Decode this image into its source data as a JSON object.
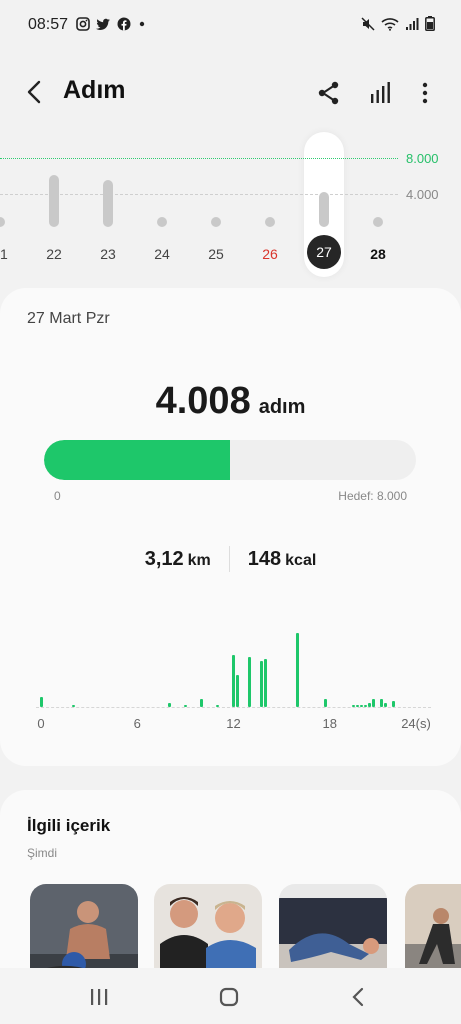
{
  "status": {
    "time": "08:57",
    "left_icons": [
      "instagram-icon",
      "twitter-icon",
      "facebook-icon",
      "dot-icon"
    ],
    "right_icons": [
      "mute-icon",
      "wifi-icon",
      "signal-icon",
      "battery-icon"
    ]
  },
  "header": {
    "title": "Adım",
    "actions": [
      "share-icon",
      "bar-chart-icon",
      "more-vertical-icon"
    ]
  },
  "week": {
    "goal_label": "8.000",
    "mid_label": "4.000",
    "days": [
      {
        "label": "21",
        "steps": 600,
        "style": "normal"
      },
      {
        "label": "22",
        "steps": 6000,
        "style": "normal"
      },
      {
        "label": "23",
        "steps": 5400,
        "style": "normal"
      },
      {
        "label": "24",
        "steps": 0,
        "style": "normal"
      },
      {
        "label": "25",
        "steps": 0,
        "style": "normal"
      },
      {
        "label": "26",
        "steps": 600,
        "style": "red"
      },
      {
        "label": "27",
        "steps": 4008,
        "style": "selected"
      },
      {
        "label": "28",
        "steps": 600,
        "style": "bold"
      }
    ]
  },
  "summary": {
    "date": "27 Mart Pzr",
    "steps": "4.008",
    "unit": "adım",
    "progress_fraction": 0.501,
    "progress_min": "0",
    "progress_goal": "Hedef: 8.000",
    "distance_value": "3,12",
    "distance_unit": "km",
    "calories_value": "148",
    "calories_unit": "kcal"
  },
  "chart_data": {
    "type": "bar",
    "x": [
      0,
      1,
      2,
      3,
      4,
      5,
      6,
      7,
      8,
      9,
      10,
      11,
      12,
      13,
      14,
      15,
      16,
      17,
      18,
      19,
      20,
      21,
      22,
      23,
      0.25,
      0.5,
      0.75,
      1.25,
      1.5,
      1.75,
      2.25,
      2.5,
      2.75,
      3.25,
      3.5,
      3.75,
      4.25,
      4.5,
      4.75,
      5.25,
      5.5,
      5.75,
      6.25,
      6.5,
      6.75,
      7.25,
      7.5,
      7.75,
      8.25,
      8.5,
      8.75,
      9.25,
      9.5,
      9.75,
      10.25,
      10.5,
      10.75,
      11.25,
      11.5,
      11.75,
      12.25,
      12.5,
      12.75,
      13.25,
      13.5,
      13.75,
      14.25,
      14.5,
      14.75,
      15.25,
      15.5,
      15.75,
      16.25,
      16.5,
      16.75,
      17.25,
      17.5,
      17.75,
      18.25,
      18.5,
      18.75,
      19.25,
      19.5,
      19.75,
      20.25,
      20.5,
      20.75,
      21.25,
      21.5,
      21.75,
      22.25,
      22.5,
      22.75,
      23.25,
      23.5,
      23.75
    ],
    "values": [
      10,
      0,
      2,
      0,
      0,
      0,
      0,
      0,
      4,
      2,
      8,
      2,
      52,
      50,
      48,
      0,
      74,
      0,
      0,
      0,
      2,
      0,
      6,
      0,
      0,
      0,
      0,
      0,
      0,
      0,
      0,
      0,
      0,
      0,
      0,
      0,
      0,
      0,
      0,
      0,
      0,
      0,
      0,
      0,
      0,
      0,
      0,
      0,
      0,
      0,
      0,
      0,
      0,
      0,
      0,
      0,
      0,
      0,
      0,
      0,
      32,
      0,
      0,
      0,
      0,
      46,
      0,
      0,
      0,
      0,
      0,
      0,
      0,
      0,
      0,
      0,
      0,
      8,
      0,
      0,
      0,
      0,
      2,
      2,
      2,
      4,
      8,
      8,
      4,
      0,
      0,
      0,
      0,
      0,
      0,
      0,
      0
    ],
    "xticks": [
      "0",
      "6",
      "12",
      "18",
      "24(s)"
    ],
    "xlim": [
      0,
      24
    ]
  },
  "related": {
    "title": "İlgili içerik",
    "subtitle": "Şimdi",
    "items": [
      {
        "name": "workout-thumb-1",
        "bg": "#6a6f78"
      },
      {
        "name": "workout-thumb-2",
        "bg": "#c7b9a8"
      },
      {
        "name": "workout-thumb-3",
        "bg": "#8c97a8"
      },
      {
        "name": "workout-thumb-4",
        "bg": "#b6a58f"
      }
    ]
  },
  "navbar": [
    "recent-apps-icon",
    "home-icon",
    "back-nav-icon"
  ],
  "colors": {
    "accent": "#1ec76a",
    "goal_line": "#2ecc71",
    "weekend": "#d9342b"
  }
}
